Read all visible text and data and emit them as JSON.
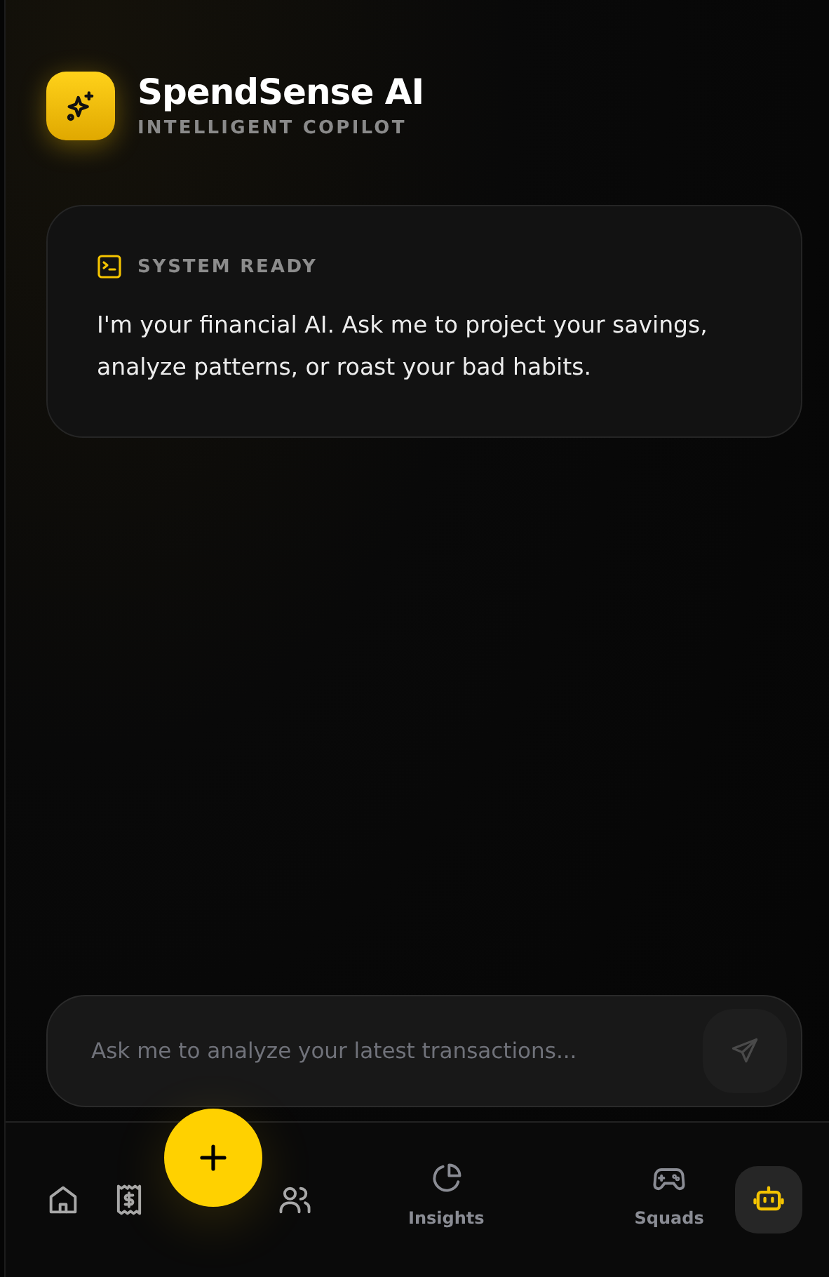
{
  "header": {
    "title": "SpendSense AI",
    "subtitle": "INTELLIGENT COPILOT"
  },
  "messages": [
    {
      "label": "SYSTEM READY",
      "text": "I'm your financial AI. Ask me to project your savings, analyze patterns, or roast your bad habits."
    }
  ],
  "composer": {
    "placeholder": "Ask me to analyze your latest transactions..."
  },
  "nav": [
    {
      "kind": "home",
      "selected": false
    },
    {
      "kind": "receipt",
      "selected": false
    },
    {
      "kind": "add",
      "selected": false
    },
    {
      "kind": "people",
      "selected": false
    },
    {
      "kind": "insights",
      "label": "Insights",
      "selected": false
    },
    {
      "kind": "squads",
      "label": "Squads",
      "selected": false
    },
    {
      "kind": "bot",
      "selected": true
    }
  ]
}
